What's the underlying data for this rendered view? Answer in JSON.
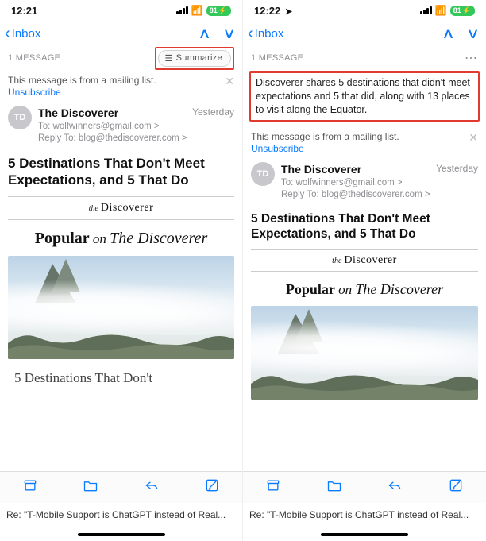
{
  "left": {
    "status": {
      "time": "12:21",
      "battery": "81"
    },
    "nav": {
      "back": "Inbox"
    },
    "count": "1 MESSAGE",
    "summarize_label": "Summarize",
    "mailing": {
      "text": "This message is from a mailing list.",
      "unsub": "Unsubscribe"
    },
    "sender": {
      "initials": "TD",
      "name": "The Discoverer",
      "to": "To: wolfwinners@gmail.com >",
      "reply": "Reply To: blog@thediscoverer.com >",
      "when": "Yesterday"
    },
    "headline": "5 Destinations That Don't Meet Expectations, and 5 That Do",
    "brand_the": "the",
    "brand_name": "Discoverer",
    "popular": {
      "pop": "Popular",
      "on": " on ",
      "src": "The Discoverer"
    },
    "subhead": "5 Destinations That Don't",
    "caption": "Re: \"T-Mobile Support is ChatGPT instead of Real..."
  },
  "right": {
    "status": {
      "time": "12:22",
      "battery": "81"
    },
    "nav": {
      "back": "Inbox"
    },
    "count": "1 MESSAGE",
    "summary": "Discoverer shares 5 destinations that didn't meet expectations and 5 that did, along with 13 places to visit along the Equator.",
    "mailing": {
      "text": "This message is from a mailing list.",
      "unsub": "Unsubscribe"
    },
    "sender": {
      "initials": "TD",
      "name": "The Discoverer",
      "to": "To: wolfwinners@gmail.com >",
      "reply": "Reply To: blog@thediscoverer.com >",
      "when": "Yesterday"
    },
    "headline": "5 Destinations That Don't Meet Expectations, and 5 That Do",
    "brand_the": "the",
    "brand_name": "Discoverer",
    "popular": {
      "pop": "Popular",
      "on": " on ",
      "src": "The Discoverer"
    },
    "caption": "Re: \"T-Mobile Support is ChatGPT instead of Real..."
  }
}
